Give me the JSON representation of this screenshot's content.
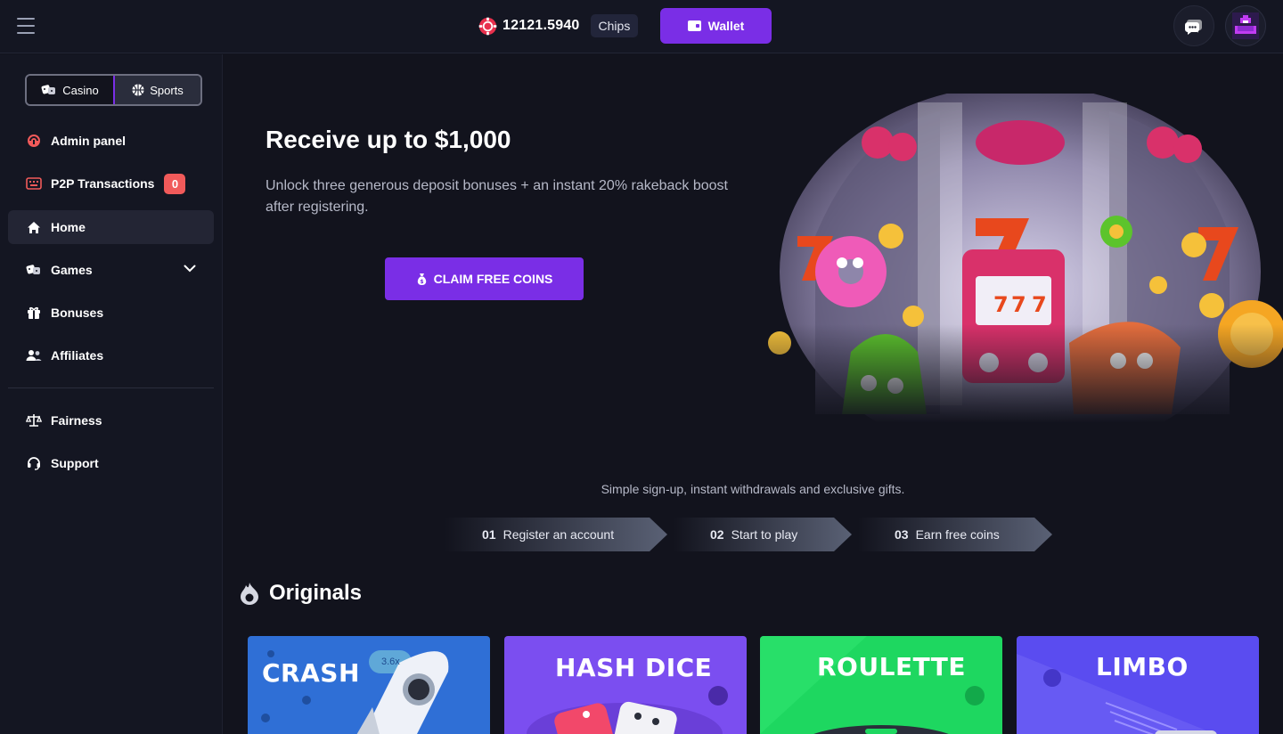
{
  "header": {
    "balance": "12121.5940",
    "currency": "Chips",
    "wallet_label": "Wallet"
  },
  "sidebar": {
    "modes": [
      {
        "label": "Casino",
        "active": true
      },
      {
        "label": "Sports",
        "active": false
      }
    ],
    "items": [
      {
        "label": "Admin panel",
        "icon": "admin-icon"
      },
      {
        "label": "P2P Transactions",
        "icon": "keyboard-icon",
        "badge": "0"
      },
      {
        "label": "Home",
        "icon": "home-icon",
        "active": true
      },
      {
        "label": "Games",
        "icon": "dice-icon",
        "expandable": true
      },
      {
        "label": "Bonuses",
        "icon": "gift-icon"
      },
      {
        "label": "Affiliates",
        "icon": "users-icon"
      },
      {
        "label": "Fairness",
        "icon": "scale-icon"
      },
      {
        "label": "Support",
        "icon": "headset-icon"
      }
    ]
  },
  "hero": {
    "title": "Receive up to $1,000",
    "subtitle": "Unlock three generous deposit bonuses + an instant 20% rakeback boost after registering.",
    "cta_label": "CLAIM FREE COINS"
  },
  "steps": {
    "caption": "Simple sign-up, instant withdrawals and exclusive gifts.",
    "items": [
      {
        "num": "01",
        "label": "Register an account"
      },
      {
        "num": "02",
        "label": "Start to play"
      },
      {
        "num": "03",
        "label": "Earn free coins"
      }
    ]
  },
  "originals": {
    "title": "Originals",
    "games": [
      {
        "label": "CRASH",
        "color": "#2f6fd6",
        "badge": "3.6x"
      },
      {
        "label": "HASH DICE",
        "color": "#7b4ef0"
      },
      {
        "label": "ROULETTE",
        "color": "#1ed760"
      },
      {
        "label": "LIMBO",
        "color": "#5a4cf0"
      }
    ]
  },
  "colors": {
    "accent": "#7a2ee6",
    "background": "#12131d",
    "panel": "#141622",
    "badge": "#f15a5a"
  }
}
